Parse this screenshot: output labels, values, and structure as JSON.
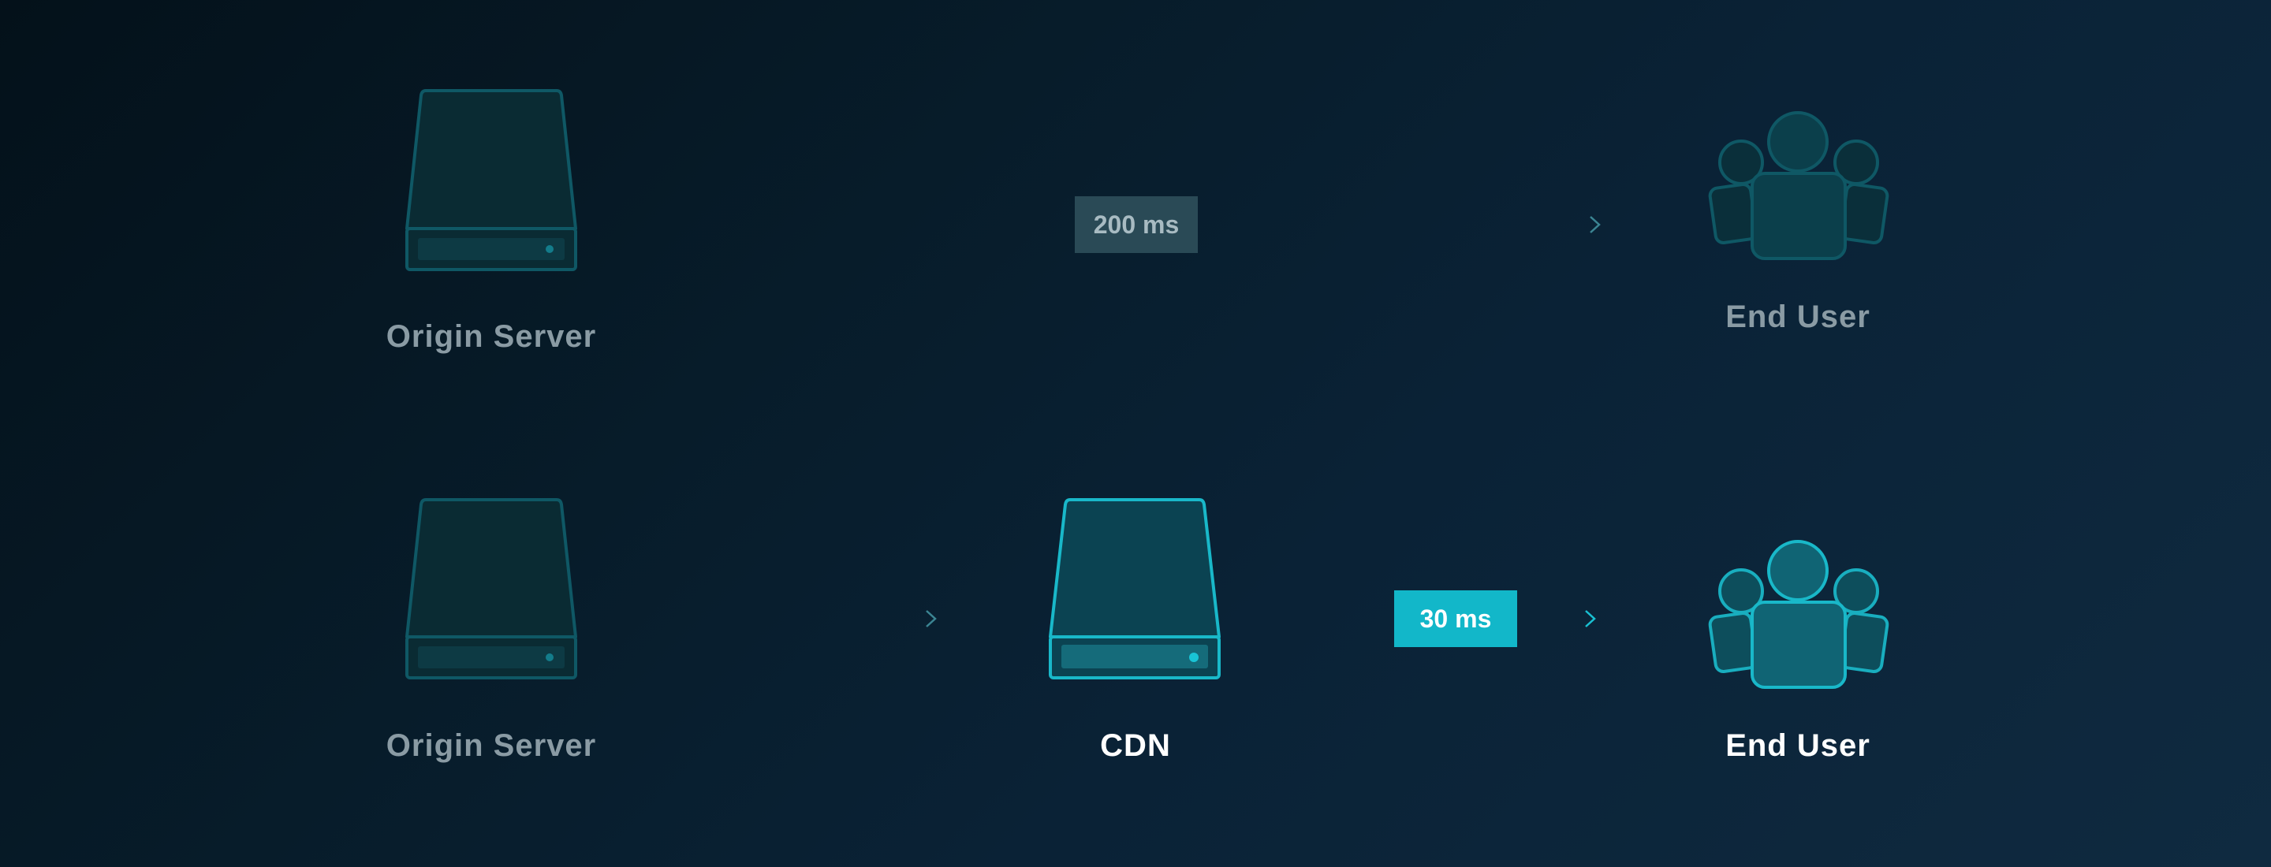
{
  "rows": [
    {
      "origin_label": "Origin Server",
      "latency": "200 ms",
      "user_label": "End User"
    },
    {
      "origin_label": "Origin Server",
      "cdn_label": "CDN",
      "latency": "30 ms",
      "user_label": "End User"
    }
  ],
  "colors": {
    "dim_icon_stroke": "#0f5865",
    "dim_icon_fill": "#0a2d36",
    "bright_icon_stroke": "#19b8c9",
    "bright_icon_fill": "#0b4352",
    "slow_badge": "#2a4a56",
    "fast_badge": "#12b7c9"
  },
  "icons": [
    "server-icon",
    "users-icon",
    "arrow-icon"
  ]
}
